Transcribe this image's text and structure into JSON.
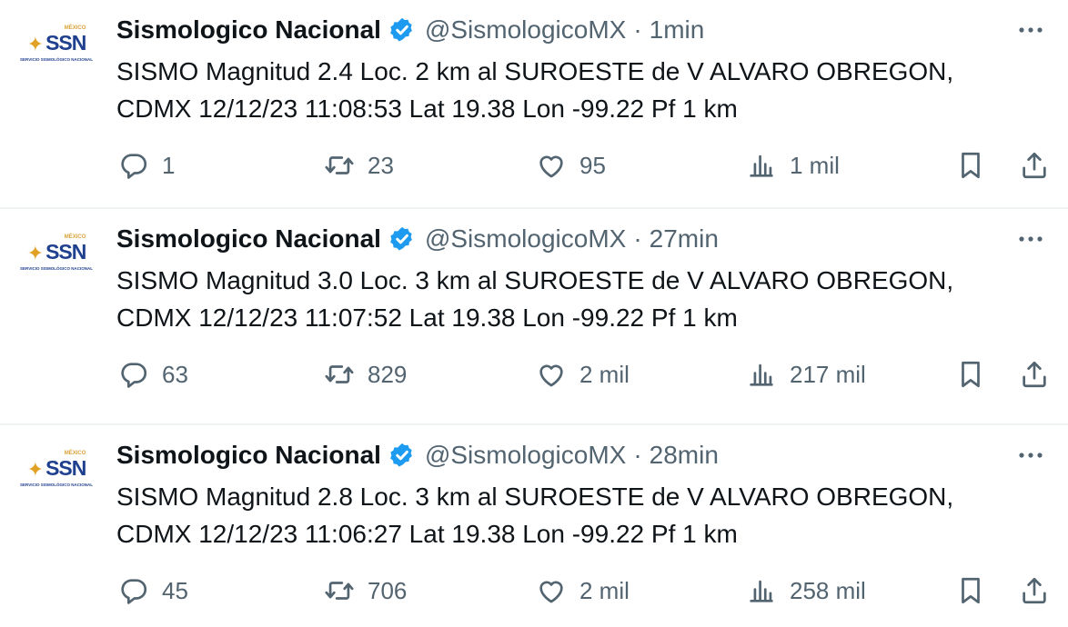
{
  "tweets": [
    {
      "account": {
        "display_name": "Sismologico Nacional",
        "handle": "@SismologicoMX",
        "verified": true,
        "avatar": {
          "logo_text": "SSN",
          "logo_country": "MÉXICO",
          "logo_subtitle": "SERVICIO SISMOLÓGICO NACIONAL"
        }
      },
      "separator": "·",
      "time": "1min",
      "text": "SISMO Magnitud 2.4 Loc. 2 km al SUROESTE de V ALVARO OBREGON, CDMX 12/12/23 11:08:53 Lat 19.38 Lon -99.22 Pf 1 km",
      "stats": {
        "replies": "1",
        "retweets": "23",
        "likes": "95",
        "views": "1 mil"
      }
    },
    {
      "account": {
        "display_name": "Sismologico Nacional",
        "handle": "@SismologicoMX",
        "verified": true,
        "avatar": {
          "logo_text": "SSN",
          "logo_country": "MÉXICO",
          "logo_subtitle": "SERVICIO SISMOLÓGICO NACIONAL"
        }
      },
      "separator": "·",
      "time": "27min",
      "text": "SISMO Magnitud 3.0 Loc. 3 km al SUROESTE de V ALVARO OBREGON, CDMX 12/12/23 11:07:52 Lat 19.38 Lon -99.22 Pf 1 km",
      "stats": {
        "replies": "63",
        "retweets": "829",
        "likes": "2 mil",
        "views": "217 mil"
      }
    },
    {
      "account": {
        "display_name": "Sismologico Nacional",
        "handle": "@SismologicoMX",
        "verified": true,
        "avatar": {
          "logo_text": "SSN",
          "logo_country": "MÉXICO",
          "logo_subtitle": "SERVICIO SISMOLÓGICO NACIONAL"
        }
      },
      "separator": "·",
      "time": "28min",
      "text": "SISMO Magnitud 2.8 Loc. 3 km al SUROESTE de V ALVARO OBREGON, CDMX 12/12/23 11:06:27 Lat 19.38 Lon -99.22 Pf 1 km",
      "stats": {
        "replies": "45",
        "retweets": "706",
        "likes": "2 mil",
        "views": "258 mil"
      }
    }
  ],
  "icons": {
    "verified": "verified-badge-icon",
    "more": "more-options-icon",
    "reply": "reply-icon",
    "retweet": "retweet-icon",
    "like": "heart-icon",
    "views": "views-chart-icon",
    "bookmark": "bookmark-icon",
    "share": "share-icon"
  },
  "colors": {
    "text_primary": "#0f1419",
    "text_secondary": "#536471",
    "verified_blue": "#1d9bf0",
    "divider": "#eff3f4",
    "logo_blue": "#1f3f8f",
    "logo_gold": "#e0a126"
  }
}
